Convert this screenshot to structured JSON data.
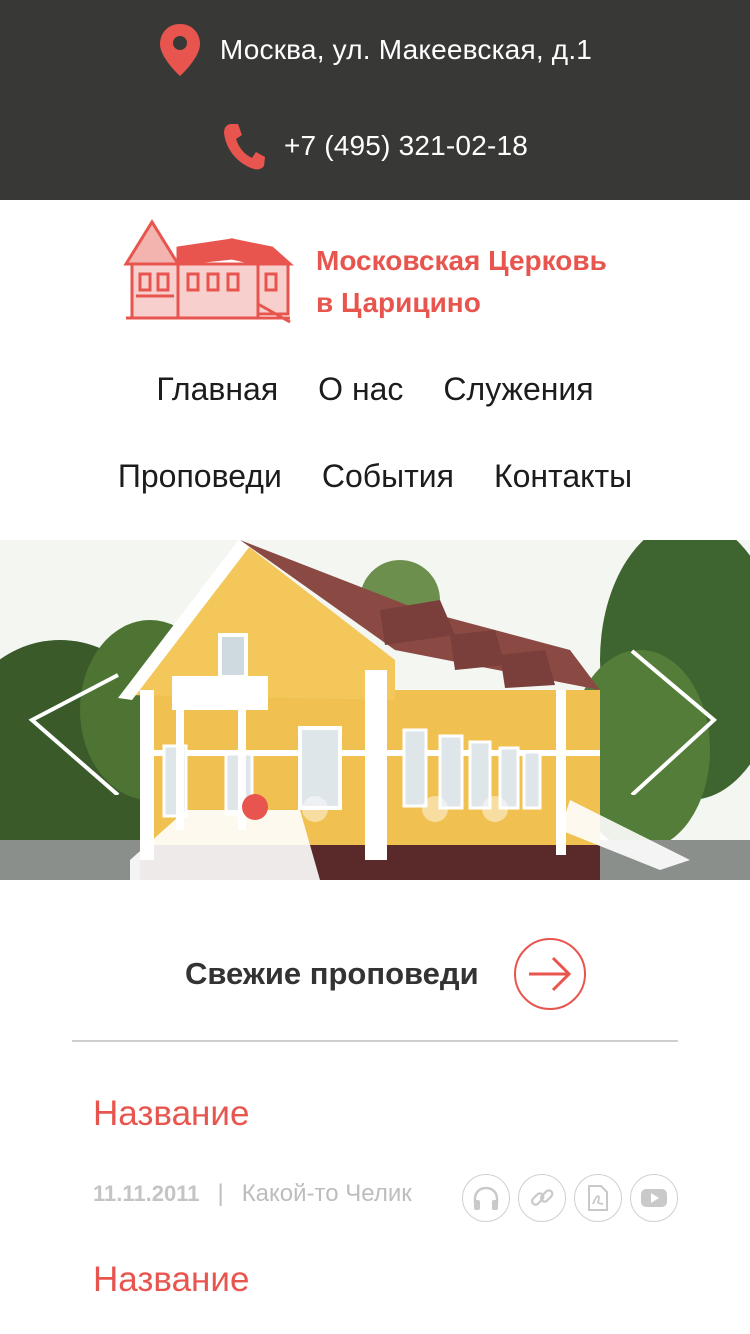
{
  "header": {
    "address": "Москва, ул. Макеевская, д.1",
    "phone": "+7 (495) 321-02-18",
    "address_icon": "map-pin-icon",
    "phone_icon": "phone-icon"
  },
  "brand": {
    "line1": "Московская Церковь",
    "line2": "в Царицино",
    "logo_icon": "church-building-logo",
    "accent_color": "#e8554e"
  },
  "nav": {
    "row1": [
      "Главная",
      "О нас",
      "Служения"
    ],
    "row2": [
      "Проповеди",
      "События",
      "Контакты"
    ]
  },
  "slider": {
    "prev_icon": "chevron-left-icon",
    "next_icon": "chevron-right-icon",
    "dots_count": 4,
    "active_dot": 0
  },
  "sermons": {
    "section_title": "Свежие проповеди",
    "go_icon": "arrow-right-icon",
    "items": [
      {
        "title": "Название",
        "date": "11.11.2011",
        "author": "Какой-то Челик"
      },
      {
        "title": "Название"
      }
    ],
    "actions": [
      "headphones-icon",
      "link-icon",
      "pdf-icon",
      "youtube-icon"
    ]
  }
}
